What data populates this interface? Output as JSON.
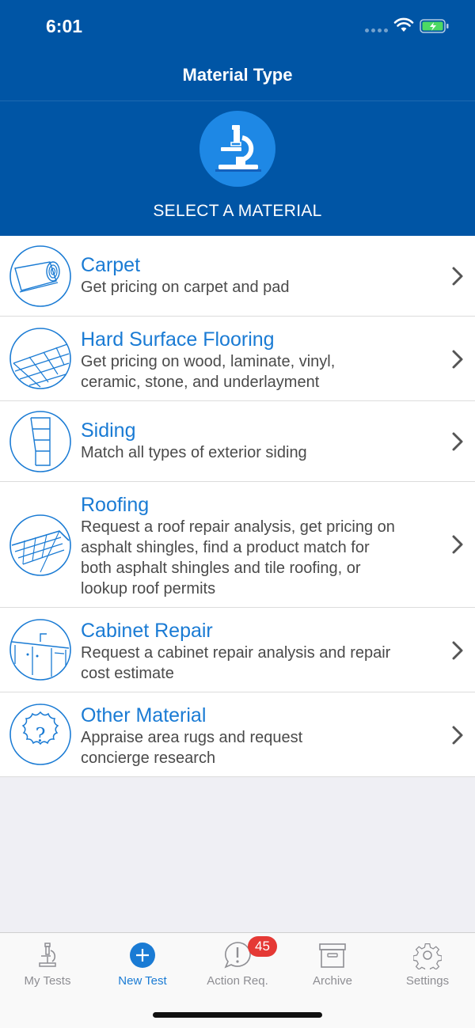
{
  "status_bar": {
    "time": "6:01",
    "icons": [
      "cellular-dots-icon",
      "wifi-icon",
      "battery-charging-icon"
    ],
    "battery_color": "#4cd964"
  },
  "header": {
    "title": "Material Type",
    "icon": "microscope-icon",
    "subtitle": "SELECT A MATERIAL",
    "background": "#0055a5",
    "icon_circle": "#1e88e5"
  },
  "materials": [
    {
      "title": "Carpet",
      "description": "Get pricing on carpet and pad",
      "icon": "carpet-roll-icon"
    },
    {
      "title": "Hard Surface Flooring",
      "description": "Get pricing on wood, laminate, vinyl,\nceramic, stone, and underlayment",
      "icon": "flooring-planks-icon"
    },
    {
      "title": "Siding",
      "description": "Match all types of exterior siding",
      "icon": "siding-icon"
    },
    {
      "title": "Roofing",
      "description": "Request a roof repair analysis, get pricing on\nasphalt shingles, find a product match for\nboth asphalt shingles and tile roofing, or\nlookup roof permits",
      "icon": "roof-shingles-icon"
    },
    {
      "title": "Cabinet Repair",
      "description": "Request a cabinet repair analysis and repair\ncost estimate",
      "icon": "cabinet-sink-icon"
    },
    {
      "title": "Other Material",
      "description": "Appraise area rugs and request\nconcierge research",
      "icon": "question-rug-icon"
    }
  ],
  "tabs": [
    {
      "label": "My Tests",
      "icon": "microscope-icon",
      "active": false
    },
    {
      "label": "New Test",
      "icon": "plus-circle-icon",
      "active": true
    },
    {
      "label": "Action Req.",
      "icon": "alert-bubble-icon",
      "active": false,
      "badge": "45"
    },
    {
      "label": "Archive",
      "icon": "archive-box-icon",
      "active": false
    },
    {
      "label": "Settings",
      "icon": "gear-icon",
      "active": false
    }
  ],
  "colors": {
    "accent": "#1a7bd4",
    "badge": "#e53935",
    "inactive_tab": "#8e8e93",
    "list_background": "#efeff4"
  }
}
